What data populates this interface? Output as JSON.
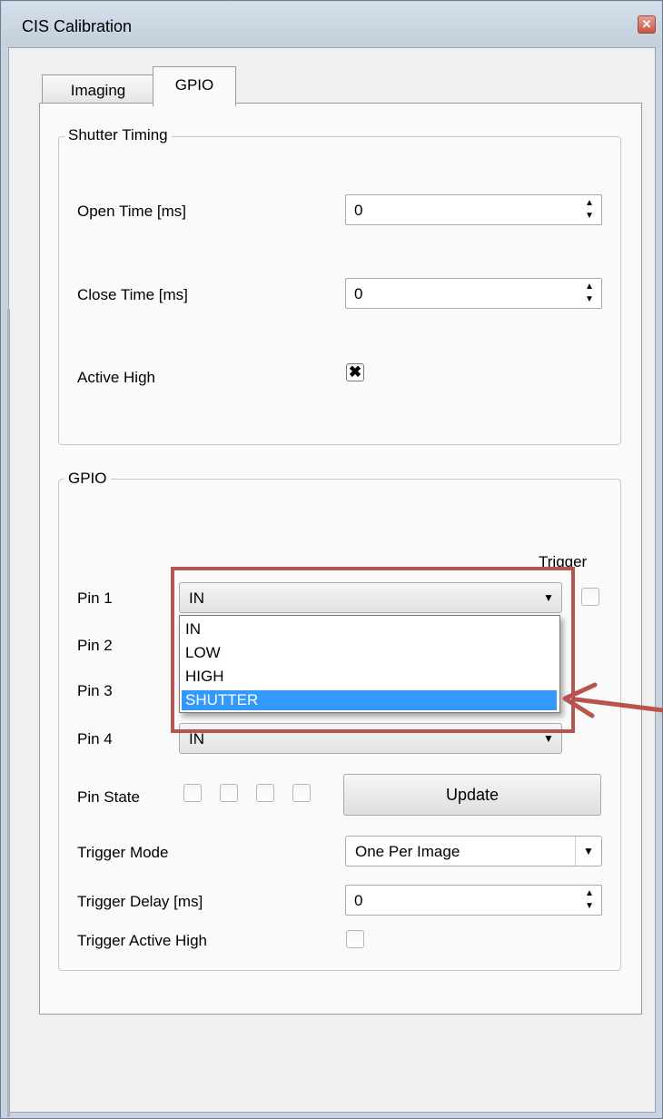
{
  "window": {
    "title": "CIS Calibration",
    "close_glyph": "✕"
  },
  "tabs": [
    {
      "label": "Imaging",
      "active": false
    },
    {
      "label": "GPIO",
      "active": true
    }
  ],
  "shutter_timing": {
    "title": "Shutter Timing",
    "open_time": {
      "label": "Open Time [ms]",
      "value": "0"
    },
    "close_time": {
      "label": "Close Time [ms]",
      "value": "0"
    },
    "active_high": {
      "label": "Active High",
      "checked": true,
      "glyph": "✖"
    }
  },
  "gpio": {
    "title": "GPIO",
    "trigger_header": "Trigger",
    "pins": [
      {
        "label": "Pin 1",
        "value": "IN",
        "open": true,
        "trigger_checked": false
      },
      {
        "label": "Pin 2"
      },
      {
        "label": "Pin 3"
      },
      {
        "label": "Pin 4",
        "value": "IN"
      }
    ],
    "dropdown_options": [
      "IN",
      "LOW",
      "HIGH",
      "SHUTTER"
    ],
    "highlighted_option": "SHUTTER",
    "pin_state": {
      "label": "Pin State",
      "states": [
        false,
        false,
        false,
        false
      ]
    },
    "update_button": "Update",
    "trigger_mode": {
      "label": "Trigger Mode",
      "value": "One Per Image"
    },
    "trigger_delay": {
      "label": "Trigger Delay [ms]",
      "value": "0"
    },
    "trigger_active_high": {
      "label": "Trigger Active High",
      "checked": false
    }
  },
  "icons": {
    "spin_up": "▲",
    "spin_down": "▼",
    "combo_arrow": "▼"
  },
  "colors": {
    "annotation": "#b85450",
    "selection": "#3399ff"
  }
}
